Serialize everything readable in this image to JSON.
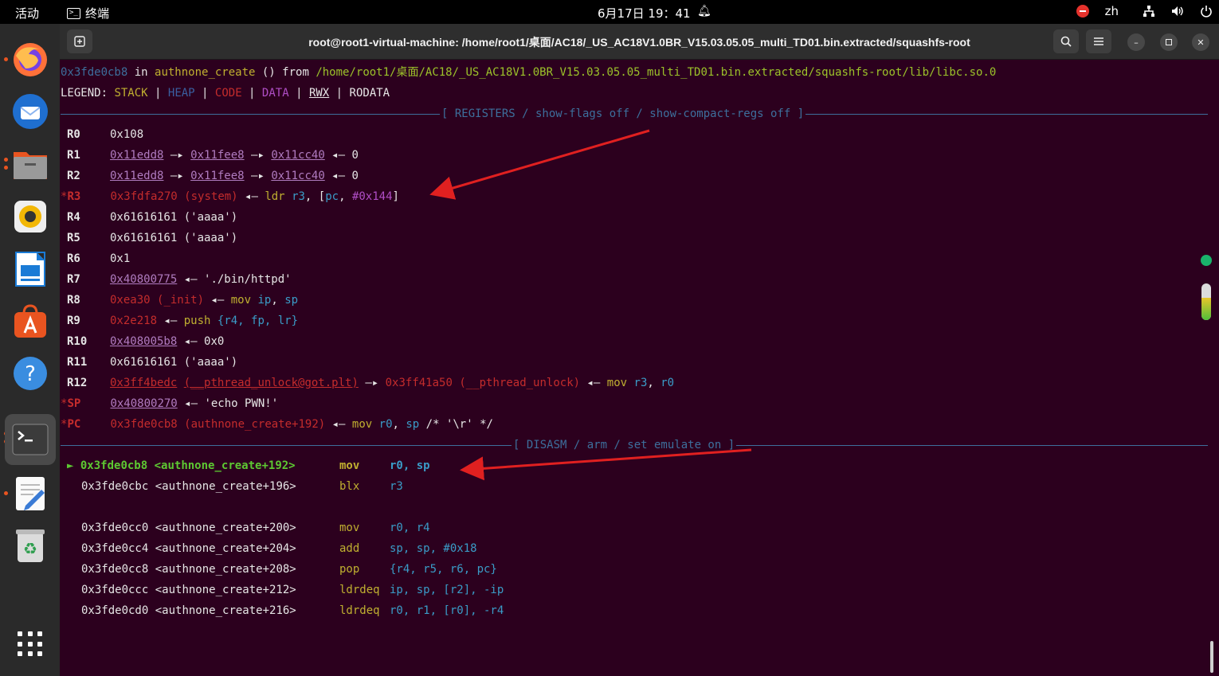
{
  "topbar": {
    "activities": "活动",
    "app_name": "终端",
    "clock": "6月17日 19：41",
    "lang": "zh"
  },
  "window": {
    "title": "root@root1-virtual-machine: /home/root1/桌面/AC18/_US_AC18V1.0BR_V15.03.05.05_multi_TD01.bin.extracted/squashfs-root"
  },
  "terminal": {
    "where": {
      "addr": "0x3fde0cb8",
      "in": " in ",
      "func": "authnone_create",
      "from": " () from ",
      "path": "/home/root1/桌面/AC18/_US_AC18V1.0BR_V15.03.05.05_multi_TD01.bin.extracted/squashfs-root/lib/libc.so.0"
    },
    "legend": {
      "label": "LEGEND: ",
      "stack": "STACK",
      "heap": "HEAP",
      "code": "CODE",
      "data": "DATA",
      "rwx": "RWX",
      "rodata": "RODATA",
      "bar": " | "
    },
    "registers_header": "[ REGISTERS / show-flags off / show-compact-regs off ]",
    "disasm_header": "[ DISASM / arm / set emulate on ]",
    "registers": {
      "r0": {
        "name": "R0",
        "val": "0x108"
      },
      "r1": {
        "name": "R1",
        "a": "0x11edd8",
        "b": "0x11fee8",
        "c": "0x11cc40",
        "d": "0"
      },
      "r2": {
        "name": "R2",
        "a": "0x11edd8",
        "b": "0x11fee8",
        "c": "0x11cc40",
        "d": "0"
      },
      "r3": {
        "star": "*",
        "name": "R3",
        "addr": "0x3fdfa270",
        "sym": "(system)",
        "mn": "ldr",
        "ops_a": "r3",
        "ops_b": "pc",
        "ops_c": "#0x144"
      },
      "r4": {
        "name": "R4",
        "val": "0x61616161 ('aaaa')"
      },
      "r5": {
        "name": "R5",
        "val": "0x61616161 ('aaaa')"
      },
      "r6": {
        "name": "R6",
        "val": "0x1"
      },
      "r7": {
        "name": "R7",
        "addr": "0x40800775",
        "str": "'./bin/httpd'"
      },
      "r8": {
        "name": "R8",
        "addr": "0xea30",
        "sym": "(_init)",
        "mn": "mov",
        "ops_a": "ip",
        "ops_b": "sp"
      },
      "r9": {
        "name": "R9",
        "addr": "0x2e218",
        "mn": "push",
        "ops": "{r4, fp, lr}"
      },
      "r10": {
        "name": "R10",
        "addr": "0x408005b8",
        "val": "0x0"
      },
      "r11": {
        "name": "R11",
        "val": "0x61616161 ('aaaa')"
      },
      "r12": {
        "name": "R12",
        "addr": "0x3ff4bedc",
        "sym": "(__pthread_unlock@got.plt)",
        "addr2": "0x3ff41a50",
        "sym2": "(__pthread_unlock)",
        "mn": "mov",
        "ops_a": "r3",
        "ops_b": "r0"
      },
      "sp": {
        "star": "*",
        "name": "SP",
        "addr": "0x40800270",
        "str": "'echo PWN!'"
      },
      "pc": {
        "star": "*",
        "name": "PC",
        "addr": "0x3fde0cb8",
        "sym": "(authnone_create+192)",
        "mn": "mov",
        "ops_a": "r0",
        "ops_b": "sp",
        "comment": "/* '\\r' */"
      }
    },
    "disasm": [
      {
        "marker": "►",
        "addr": "0x3fde0cb8",
        "sym": "<authnone_create+192>",
        "mn": "mov",
        "ops": "r0, sp"
      },
      {
        "marker": "",
        "addr": "0x3fde0cbc",
        "sym": "<authnone_create+196>",
        "mn": "blx",
        "ops": "r3"
      },
      {
        "marker": "",
        "addr": "0x3fde0cc0",
        "sym": "<authnone_create+200>",
        "mn": "mov",
        "ops": "r0, r4"
      },
      {
        "marker": "",
        "addr": "0x3fde0cc4",
        "sym": "<authnone_create+204>",
        "mn": "add",
        "ops": "sp, sp, #0x18"
      },
      {
        "marker": "",
        "addr": "0x3fde0cc8",
        "sym": "<authnone_create+208>",
        "mn": "pop",
        "ops": "{r4, r5, r6, pc}"
      },
      {
        "marker": "",
        "addr": "0x3fde0ccc",
        "sym": "<authnone_create+212>",
        "mn": "ldrdeq",
        "ops": "ip, sp, [r2], -ip"
      },
      {
        "marker": "",
        "addr": "0x3fde0cd0",
        "sym": "<authnone_create+216>",
        "mn": "ldrdeq",
        "ops": "r0, r1, [r0], -r4"
      }
    ]
  },
  "colors": {
    "terminal_bg": "#2c001e",
    "accent_orange": "#e95420",
    "annotation_arrow": "#e02020"
  },
  "icons": {
    "dock": [
      "firefox-icon",
      "thunderbird-icon",
      "files-icon",
      "rhythmbox-icon",
      "libreoffice-writer-icon",
      "app-center-icon",
      "help-icon",
      "terminal-icon",
      "text-editor-icon",
      "trash-icon",
      "show-apps-icon"
    ]
  }
}
